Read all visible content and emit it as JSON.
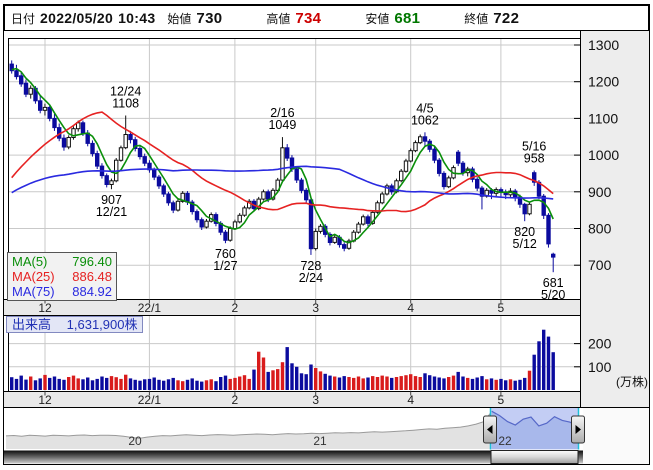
{
  "header": {
    "date_label": "日付",
    "date": "2022/05/20",
    "time": "10:43",
    "open_label": "始値",
    "open": "730",
    "high_label": "高値",
    "high": "734",
    "low_label": "安値",
    "low": "681",
    "close_label": "終値",
    "close": "722"
  },
  "colors": {
    "open_close_text": "#111111",
    "high_text": "#cc0000",
    "low_text": "#007700",
    "candle_down": "#0b0b9e",
    "candle_up_stroke": "#111111",
    "vol_up": "#d91c1c",
    "vol_down": "#0b0b9e",
    "ma5": "#0a8f0a",
    "ma25": "#e62222",
    "ma75": "#2a2ae0",
    "grid": "#c9c9c9",
    "panel": "#ededed",
    "strip": "#e9e9e9",
    "window_fill": "#c3cdf4",
    "window_line": "#5668c8",
    "window_under": "#9fb0e8",
    "overview_line": "#9a9a9a",
    "overview_fill": "#e2e2e2",
    "handle_cyan": "#1ec0d8"
  },
  "ma_legend": [
    {
      "label": "MA(5)",
      "value": "796.40",
      "color": "#0a8f0a"
    },
    {
      "label": "MA(25)",
      "value": "886.48",
      "color": "#e62222"
    },
    {
      "label": "MA(75)",
      "value": "884.92",
      "color": "#2a2ae0"
    }
  ],
  "volume_label": {
    "name": "出来高",
    "value": "1,631,900株"
  },
  "chart_data": {
    "type": "candlestick",
    "price_axis": {
      "ticks": [
        700,
        800,
        900,
        1000,
        1100,
        1200,
        1300
      ]
    },
    "volume_axis": {
      "ticks": [
        100,
        200
      ],
      "unit_label": "(万株)"
    },
    "x_ticks": [
      {
        "label": "12",
        "index": 7
      },
      {
        "label": "22/1",
        "index": 29
      },
      {
        "label": "2",
        "index": 47
      },
      {
        "label": "3",
        "index": 64
      },
      {
        "label": "4",
        "index": 84
      },
      {
        "label": "5",
        "index": 103
      }
    ],
    "candles": [
      [
        1248,
        1258,
        1222,
        1230
      ],
      [
        1230,
        1246,
        1206,
        1214
      ],
      [
        1216,
        1228,
        1186,
        1194
      ],
      [
        1196,
        1206,
        1158,
        1166
      ],
      [
        1166,
        1190,
        1154,
        1182
      ],
      [
        1182,
        1188,
        1140,
        1148
      ],
      [
        1148,
        1162,
        1114,
        1122
      ],
      [
        1122,
        1140,
        1108,
        1130
      ],
      [
        1130,
        1136,
        1092,
        1100
      ],
      [
        1100,
        1112,
        1066,
        1075
      ],
      [
        1075,
        1086,
        1038,
        1046
      ],
      [
        1046,
        1056,
        1012,
        1022
      ],
      [
        1022,
        1054,
        1016,
        1048
      ],
      [
        1048,
        1078,
        1042,
        1072
      ],
      [
        1072,
        1094,
        1064,
        1088
      ],
      [
        1088,
        1094,
        1052,
        1060
      ],
      [
        1060,
        1068,
        1024,
        1032
      ],
      [
        1032,
        1040,
        996,
        1004
      ],
      [
        1004,
        1012,
        962,
        970
      ],
      [
        970,
        978,
        936,
        944
      ],
      [
        944,
        950,
        912,
        920
      ],
      [
        920,
        936,
        907,
        930
      ],
      [
        930,
        992,
        926,
        986
      ],
      [
        986,
        1026,
        982,
        1020
      ],
      [
        1020,
        1108,
        1016,
        1056
      ],
      [
        1056,
        1066,
        1032,
        1042
      ],
      [
        1042,
        1050,
        1010,
        1018
      ],
      [
        1018,
        1026,
        988,
        996
      ],
      [
        996,
        1004,
        970,
        978
      ],
      [
        978,
        986,
        952,
        960
      ],
      [
        960,
        966,
        932,
        940
      ],
      [
        940,
        946,
        908,
        916
      ],
      [
        916,
        922,
        886,
        894
      ],
      [
        894,
        900,
        862,
        870
      ],
      [
        870,
        876,
        842,
        850
      ],
      [
        850,
        880,
        846,
        874
      ],
      [
        874,
        902,
        870,
        896
      ],
      [
        896,
        902,
        864,
        872
      ],
      [
        872,
        878,
        838,
        846
      ],
      [
        846,
        852,
        816,
        824
      ],
      [
        824,
        830,
        796,
        804
      ],
      [
        804,
        826,
        800,
        820
      ],
      [
        820,
        844,
        816,
        838
      ],
      [
        838,
        844,
        806,
        814
      ],
      [
        814,
        820,
        782,
        790
      ],
      [
        790,
        796,
        760,
        768
      ],
      [
        768,
        806,
        764,
        800
      ],
      [
        800,
        824,
        796,
        818
      ],
      [
        818,
        842,
        814,
        836
      ],
      [
        836,
        862,
        832,
        856
      ],
      [
        856,
        880,
        852,
        874
      ],
      [
        874,
        880,
        846,
        854
      ],
      [
        854,
        886,
        850,
        880
      ],
      [
        880,
        906,
        876,
        900
      ],
      [
        900,
        906,
        872,
        880
      ],
      [
        880,
        910,
        876,
        904
      ],
      [
        904,
        938,
        900,
        932
      ],
      [
        932,
        1049,
        928,
        1020
      ],
      [
        1020,
        1030,
        984,
        992
      ],
      [
        992,
        1000,
        954,
        962
      ],
      [
        962,
        970,
        924,
        932
      ],
      [
        932,
        938,
        896,
        904
      ],
      [
        904,
        910,
        870,
        878
      ],
      [
        878,
        884,
        728,
        745
      ],
      [
        745,
        800,
        740,
        792
      ],
      [
        792,
        812,
        786,
        806
      ],
      [
        806,
        812,
        776,
        784
      ],
      [
        784,
        790,
        754,
        762
      ],
      [
        762,
        782,
        758,
        776
      ],
      [
        776,
        782,
        748,
        756
      ],
      [
        756,
        762,
        738,
        746
      ],
      [
        746,
        772,
        742,
        766
      ],
      [
        766,
        796,
        762,
        790
      ],
      [
        790,
        818,
        786,
        812
      ],
      [
        812,
        838,
        808,
        832
      ],
      [
        832,
        838,
        806,
        814
      ],
      [
        814,
        850,
        810,
        844
      ],
      [
        844,
        876,
        840,
        870
      ],
      [
        870,
        900,
        866,
        894
      ],
      [
        894,
        922,
        890,
        916
      ],
      [
        916,
        922,
        892,
        900
      ],
      [
        900,
        936,
        896,
        930
      ],
      [
        930,
        962,
        926,
        956
      ],
      [
        956,
        990,
        952,
        984
      ],
      [
        984,
        1018,
        980,
        1012
      ],
      [
        1012,
        1040,
        1008,
        1034
      ],
      [
        1034,
        1056,
        1030,
        1050
      ],
      [
        1050,
        1062,
        1024,
        1038
      ],
      [
        1038,
        1044,
        1008,
        1016
      ],
      [
        1016,
        1022,
        978,
        986
      ],
      [
        986,
        992,
        942,
        950
      ],
      [
        950,
        956,
        906,
        914
      ],
      [
        914,
        944,
        910,
        938
      ],
      [
        938,
        972,
        934,
        966
      ],
      [
        1008,
        1014,
        970,
        978
      ],
      [
        978,
        984,
        944,
        952
      ],
      [
        952,
        968,
        942,
        962
      ],
      [
        962,
        968,
        926,
        934
      ],
      [
        934,
        940,
        902,
        910
      ],
      [
        910,
        916,
        852,
        888
      ],
      [
        888,
        910,
        884,
        904
      ],
      [
        904,
        910,
        880,
        896
      ],
      [
        896,
        912,
        888,
        906
      ],
      [
        906,
        912,
        886,
        898
      ],
      [
        898,
        906,
        880,
        892
      ],
      [
        892,
        910,
        886,
        902
      ],
      [
        902,
        908,
        874,
        886
      ],
      [
        886,
        892,
        856,
        866
      ],
      [
        866,
        870,
        820,
        840
      ],
      [
        840,
        872,
        836,
        866
      ],
      [
        952,
        958,
        916,
        926
      ],
      [
        926,
        932,
        880,
        888
      ],
      [
        888,
        894,
        826,
        836
      ],
      [
        836,
        842,
        748,
        758
      ],
      [
        730,
        734,
        681,
        722
      ]
    ],
    "volumes": [
      55,
      48,
      62,
      45,
      58,
      42,
      50,
      65,
      52,
      58,
      48,
      44,
      56,
      62,
      50,
      46,
      54,
      42,
      48,
      58,
      52,
      60,
      55,
      48,
      66,
      50,
      44,
      40,
      46,
      48,
      54,
      44,
      40,
      46,
      52,
      42,
      38,
      44,
      50,
      40,
      36,
      42,
      46,
      38,
      56,
      62,
      48,
      52,
      58,
      64,
      48,
      88,
      165,
      140,
      78,
      85,
      90,
      120,
      185,
      115,
      100,
      72,
      68,
      110,
      95,
      80,
      70,
      62,
      58,
      54,
      60,
      56,
      52,
      58,
      50,
      54,
      60,
      56,
      62,
      58,
      52,
      56,
      60,
      64,
      68,
      60,
      56,
      72,
      64,
      58,
      54,
      50,
      56,
      62,
      78,
      58,
      52,
      48,
      54,
      60,
      46,
      50,
      44,
      48,
      42,
      46,
      40,
      44,
      52,
      83,
      152,
      210,
      260,
      230,
      163
    ],
    "annotations": [
      {
        "index": 21,
        "price": 907,
        "pos": "below",
        "lines": [
          "907",
          "12/21"
        ]
      },
      {
        "index": 24,
        "price": 1108,
        "pos": "above",
        "lines": [
          "12/24",
          "1108"
        ]
      },
      {
        "index": 45,
        "price": 760,
        "pos": "below",
        "lines": [
          "760",
          "1/27"
        ]
      },
      {
        "index": 57,
        "price": 1049,
        "pos": "above",
        "lines": [
          "2/16",
          "1049"
        ]
      },
      {
        "index": 63,
        "price": 728,
        "pos": "below",
        "lines": [
          "728",
          "2/24"
        ]
      },
      {
        "index": 87,
        "price": 1062,
        "pos": "above",
        "lines": [
          "4/5",
          "1062"
        ]
      },
      {
        "index": 108,
        "price": 820,
        "pos": "below",
        "lines": [
          "820",
          "5/12"
        ]
      },
      {
        "index": 110,
        "price": 958,
        "pos": "above",
        "lines": [
          "5/16",
          "958"
        ]
      },
      {
        "index": 114,
        "price": 681,
        "pos": "below",
        "lines": [
          "681",
          "5/20"
        ]
      }
    ],
    "ma": {
      "periods": [
        5,
        25,
        75
      ],
      "seed": [
        830,
        826,
        834,
        828,
        838,
        832,
        824,
        830,
        836,
        842,
        835,
        828,
        832,
        840,
        846,
        838,
        830,
        834,
        842,
        848,
        840,
        835,
        845,
        852,
        844,
        838,
        848,
        856,
        850,
        842,
        852,
        860,
        868,
        875,
        885,
        1150,
        1200,
        1240,
        1250,
        1245
      ]
    },
    "overview": {
      "values": [
        430,
        445,
        420,
        450,
        440,
        425,
        455,
        445,
        430,
        450,
        460,
        440,
        455,
        450,
        445,
        420,
        380,
        350,
        390,
        420,
        440,
        430,
        450,
        470,
        455,
        440,
        460,
        475,
        465,
        450,
        470,
        480,
        495,
        485,
        470,
        490,
        505,
        495,
        500,
        515,
        505,
        520,
        535,
        525,
        540,
        530,
        550,
        565,
        555,
        570,
        585,
        600,
        620,
        640,
        660,
        650,
        680,
        700,
        720,
        760,
        820,
        900,
        1240,
        1100,
        900,
        790,
        980,
        1049,
        760,
        850,
        1062,
        940,
        880,
        722
      ],
      "year_labels": [
        {
          "label": "20",
          "x": 135
        },
        {
          "label": "21",
          "x": 320
        },
        {
          "label": "22",
          "x": 505
        }
      ],
      "window": [
        490,
        578
      ]
    }
  }
}
